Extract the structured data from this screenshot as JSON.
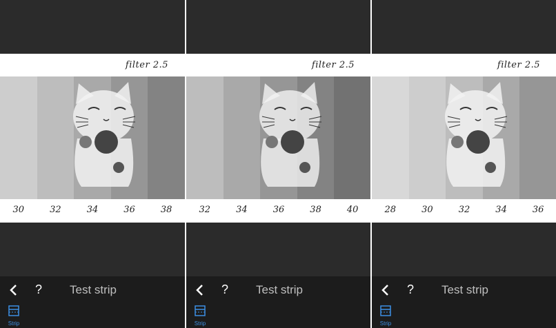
{
  "panels": [
    {
      "filter_label": "filter 2.5",
      "ticks": [
        "30",
        "32",
        "34",
        "36",
        "38"
      ],
      "toolbar": {
        "title": "Test strip",
        "help_label": "?",
        "tab_label": "Strip"
      }
    },
    {
      "filter_label": "filter 2.5",
      "ticks": [
        "32",
        "34",
        "36",
        "38",
        "40"
      ],
      "toolbar": {
        "title": "Test strip",
        "help_label": "?",
        "tab_label": "Strip"
      }
    },
    {
      "filter_label": "filter 2.5",
      "ticks": [
        "28",
        "30",
        "32",
        "34",
        "36"
      ],
      "toolbar": {
        "title": "Test strip",
        "help_label": "?",
        "tab_label": "Strip"
      }
    }
  ],
  "colors": {
    "background": "#2b2b2b",
    "toolbar": "#1c1c1c",
    "accent": "#3d8fe3",
    "title_text": "#bfbfbf"
  },
  "icons": {
    "back": "chevron-left-icon",
    "strip": "strip-icon"
  },
  "photo": {
    "subject": "lucky cat figurine"
  }
}
